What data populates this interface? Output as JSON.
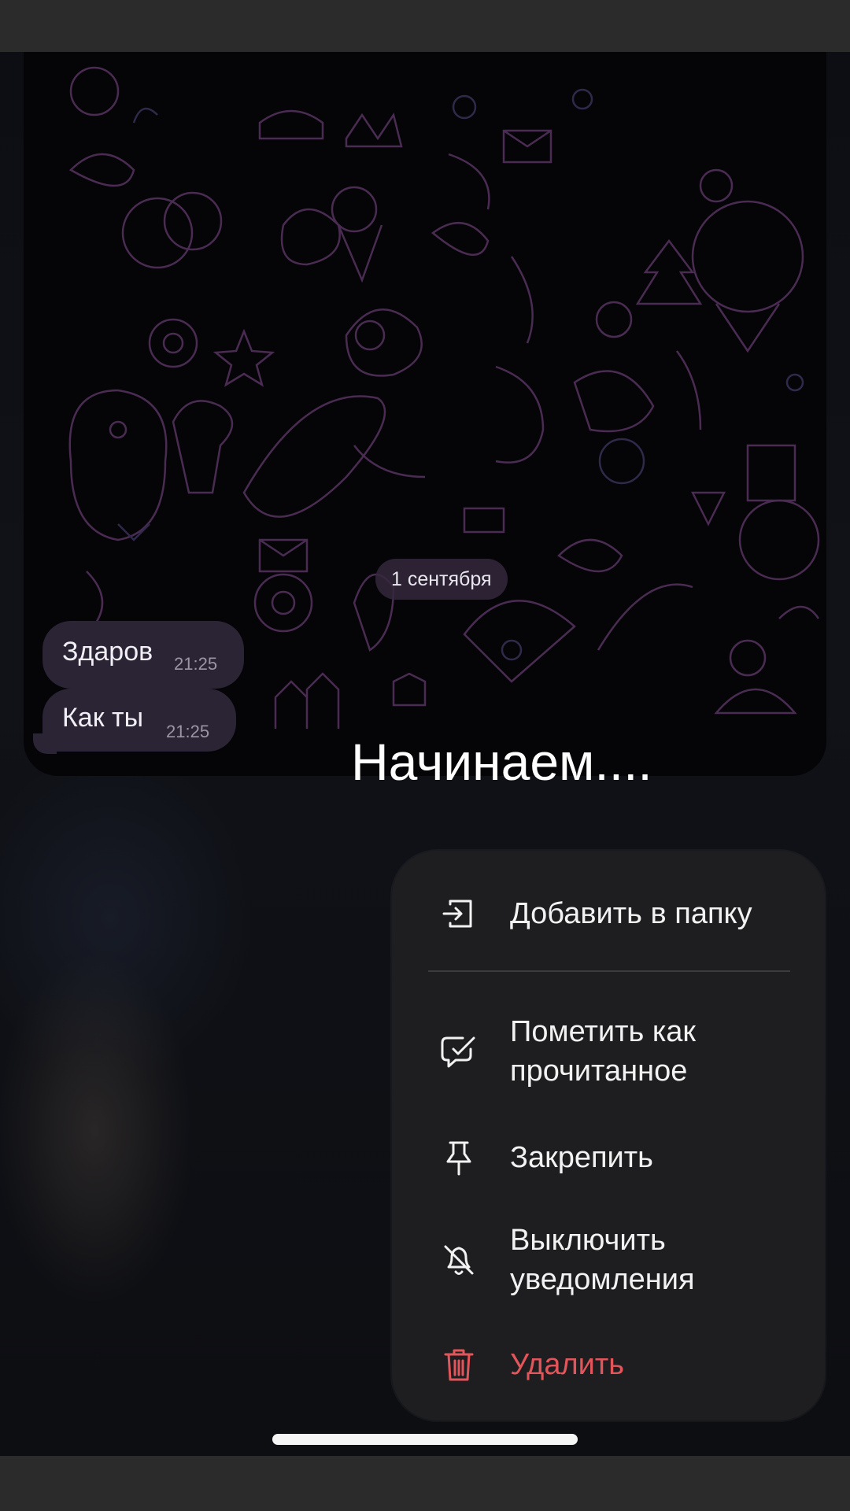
{
  "chat": {
    "date_separator": "1 сентября",
    "messages": [
      {
        "text": "Здаров",
        "time": "21:25"
      },
      {
        "text": "Как ты",
        "time": "21:25"
      }
    ]
  },
  "overlay_caption": "Начинаем....",
  "context_menu": {
    "items": [
      {
        "label": "Добавить в папку",
        "icon": "folder-add-icon"
      },
      {
        "label_line1": "Пометить как",
        "label_line2": "прочитанное",
        "icon": "chat-check-icon"
      },
      {
        "label": "Закрепить",
        "icon": "pin-icon"
      },
      {
        "label_line1": "Выключить",
        "label_line2": "уведомления",
        "icon": "bell-off-icon"
      },
      {
        "label": "Удалить",
        "icon": "trash-icon"
      }
    ],
    "danger_color": "#e2555a"
  }
}
